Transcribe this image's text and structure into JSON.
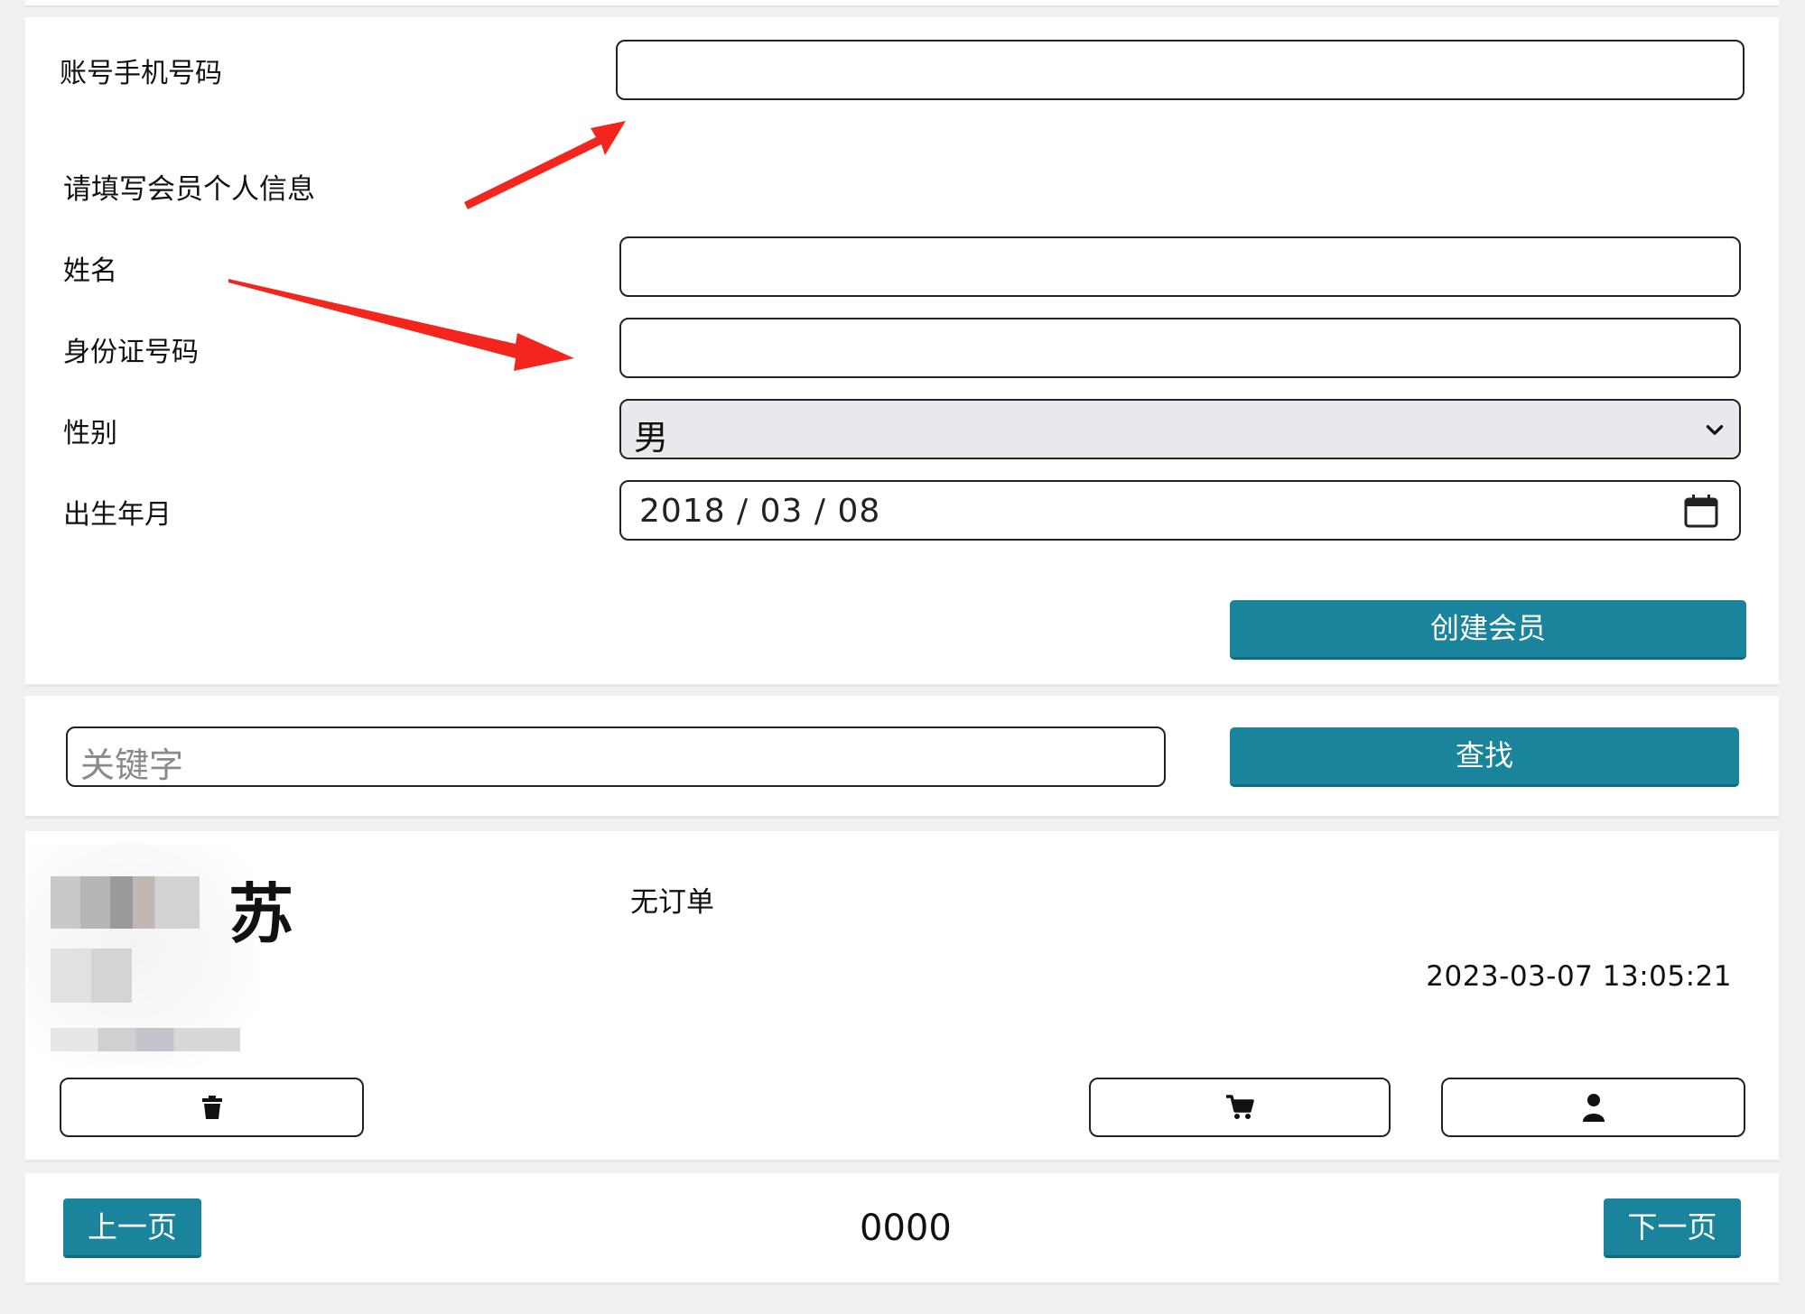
{
  "form": {
    "account_label": "账号手机号码",
    "section_title": "请填写会员个人信息",
    "name_label": "姓名",
    "id_label": "身份证号码",
    "gender_label": "性别",
    "gender_value": "男",
    "birth_label": "出生年月",
    "birth_value": "2018 / 03 / 08",
    "create_button": "创建会员"
  },
  "search": {
    "placeholder": "关键字",
    "button": "查找"
  },
  "member": {
    "name": "苏",
    "order_status": "无订单",
    "timestamp": "2023-03-07 13:05:21",
    "icons": [
      "trash-icon",
      "cart-icon",
      "user-icon"
    ]
  },
  "pager": {
    "prev": "上一页",
    "page": "0000",
    "next": "下一页"
  },
  "colors": {
    "accent": "#19849b",
    "annotation_arrow": "#f2261c"
  }
}
